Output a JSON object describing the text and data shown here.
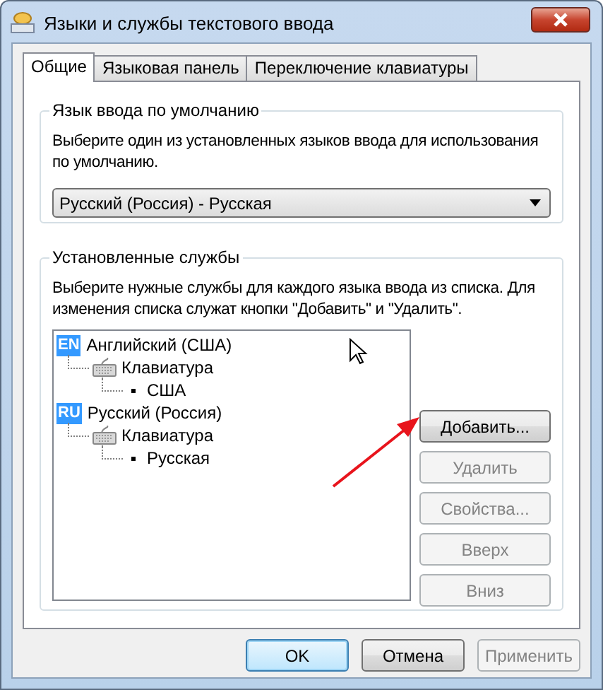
{
  "window": {
    "title": "Языки и службы текстового ввода"
  },
  "tabs": [
    {
      "label": "Общие",
      "selected": true
    },
    {
      "label": "Языковая панель",
      "selected": false
    },
    {
      "label": "Переключение клавиатуры",
      "selected": false
    }
  ],
  "default_language": {
    "title": "Язык ввода по умолчанию",
    "description": "Выберите один из установленных языков ввода для использования по умолчанию.",
    "dropdown": {
      "value": "Русский (Россия) - Русская"
    }
  },
  "installed_services": {
    "title": "Установленные службы",
    "description": "Выберите нужные службы для каждого языка ввода из списка. Для изменения списка служат кнопки \"Добавить\" и \"Удалить\".",
    "tree": [
      {
        "kind": "language",
        "badge": "EN",
        "label": "Английский (США)",
        "children": [
          {
            "kind": "keyboard",
            "label": "Клавиатура",
            "children": [
              {
                "kind": "layout",
                "label": "США"
              }
            ]
          }
        ]
      },
      {
        "kind": "language",
        "badge": "RU",
        "label": "Русский (Россия)",
        "children": [
          {
            "kind": "keyboard",
            "label": "Клавиатура",
            "children": [
              {
                "kind": "layout",
                "label": "Русская"
              }
            ]
          }
        ]
      }
    ],
    "buttons": [
      {
        "label": "Добавить...",
        "disabled": false
      },
      {
        "label": "Удалить",
        "disabled": true
      },
      {
        "label": "Свойства...",
        "disabled": true
      },
      {
        "label": "Вверх",
        "disabled": true
      },
      {
        "label": "Вниз",
        "disabled": true
      }
    ]
  },
  "dialog_buttons": [
    {
      "label": "OK",
      "default": true,
      "disabled": false
    },
    {
      "label": "Отмена",
      "default": false,
      "disabled": false
    },
    {
      "label": "Применить",
      "default": false,
      "disabled": true
    }
  ]
}
